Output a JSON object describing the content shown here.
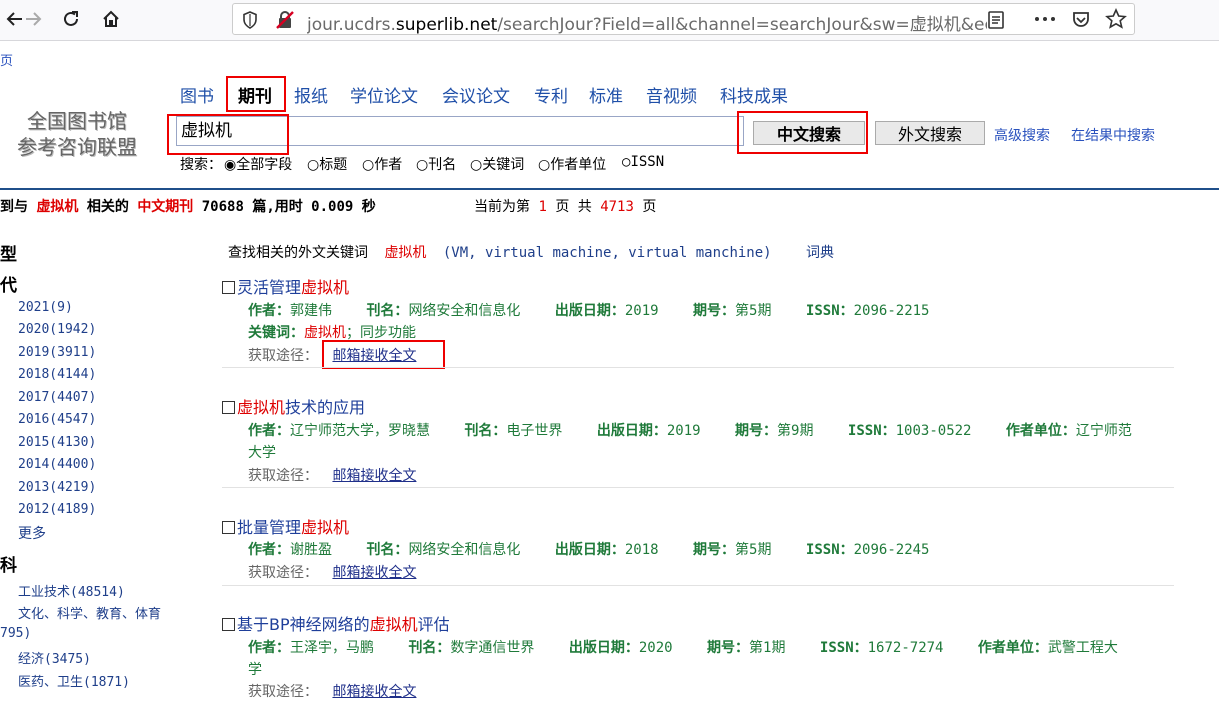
{
  "browser": {
    "url_host_prefix": "jour.ucdrs.",
    "url_host_main": "superlib.net",
    "url_path": "/searchJour?Field=all&channel=searchJour&sw=虚拟机&ec"
  },
  "top_partial_link": "页",
  "logo": {
    "line1": "全国图书馆",
    "line2": "参考咨询联盟"
  },
  "tabs": [
    "图书",
    "期刊",
    "报纸",
    "学位论文",
    "会议论文",
    "专利",
    "标准",
    "音视频",
    "科技成果"
  ],
  "search": {
    "value": "虚拟机",
    "cn_button": "中文搜索",
    "en_button": "外文搜索",
    "advanced": "高级搜索",
    "within": "在结果中搜索",
    "label": "搜索：",
    "options": [
      "全部字段",
      "标题",
      "作者",
      "刊名",
      "关键词",
      "作者单位",
      "ISSN"
    ]
  },
  "summary": {
    "prefix": "到与",
    "keyword": "虚拟机",
    "mid": "相关的",
    "type": "中文期刊",
    "count_text": "70688 篇,用时 0.009 秒",
    "page_prefix": "当前为第",
    "page": "1",
    "page_mid": "页 共",
    "total_pages": "4713",
    "page_suffix": "页"
  },
  "sidebar": {
    "h_type": "型",
    "h_era": "代",
    "years": [
      "2021(9)",
      "2020(1942)",
      "2019(3911)",
      "2018(4144)",
      "2017(4407)",
      "2016(4547)",
      "2015(4130)",
      "2014(4400)",
      "2013(4219)",
      "2012(4189)"
    ],
    "more": "更多",
    "h_subject": "科",
    "subjects": [
      "工业技术(48514)",
      "文化、科学、教育、体育",
      "795)",
      "经济(3475)",
      "医药、卫生(1871)"
    ]
  },
  "related": {
    "label": "查找相关的外文关键词",
    "keyword": "虚拟机",
    "terms": "(VM, virtual machine, virtual manchine)",
    "dict": "词典"
  },
  "results": [
    {
      "title_pre": "灵活管理",
      "title_hl": "虚拟机",
      "title_post": "",
      "author_k": "作者：",
      "author": "郭建伟",
      "journal_k": "刊名：",
      "journal": "网络安全和信息化",
      "date_k": "出版日期：",
      "date": "2019",
      "issue_k": "期号：",
      "issue": "第5期",
      "issn_k": "ISSN：",
      "issn": "2096-2215",
      "kw_k": "关键词：",
      "kw_hl": "虚拟机",
      "kw_rest": "；同步功能",
      "get_label": "获取途径：",
      "get_link": "邮箱接收全文"
    },
    {
      "title_pre": "",
      "title_hl": "虚拟机",
      "title_post": "技术的应用",
      "author_k": "作者：",
      "author": "辽宁师范大学，罗晓慧",
      "journal_k": "刊名：",
      "journal": "电子世界",
      "date_k": "出版日期：",
      "date": "2019",
      "issue_k": "期号：",
      "issue": "第9期",
      "issn_k": "ISSN：",
      "issn": "1003-0522",
      "unit_k": "作者单位：",
      "unit": "辽宁师范",
      "unit_cont": "大学",
      "get_label": "获取途径：",
      "get_link": "邮箱接收全文"
    },
    {
      "title_pre": "批量管理",
      "title_hl": "虚拟机",
      "title_post": "",
      "author_k": "作者：",
      "author": "谢胜盈",
      "journal_k": "刊名：",
      "journal": "网络安全和信息化",
      "date_k": "出版日期：",
      "date": "2018",
      "issue_k": "期号：",
      "issue": "第5期",
      "issn_k": "ISSN：",
      "issn": "2096-2245",
      "get_label": "获取途径：",
      "get_link": "邮箱接收全文"
    },
    {
      "title_pre": "基于BP神经网络的",
      "title_hl": "虚拟机",
      "title_post": "评估",
      "author_k": "作者：",
      "author": "王泽宇，马鹏",
      "journal_k": "刊名：",
      "journal": "数字通信世界",
      "date_k": "出版日期：",
      "date": "2020",
      "issue_k": "期号：",
      "issue": "第1期",
      "issn_k": "ISSN：",
      "issn": "1672-7274",
      "unit_k": "作者单位：",
      "unit": "武警工程大",
      "unit_cont": "学",
      "get_label": "获取途径：",
      "get_link": "邮箱接收全文"
    }
  ]
}
